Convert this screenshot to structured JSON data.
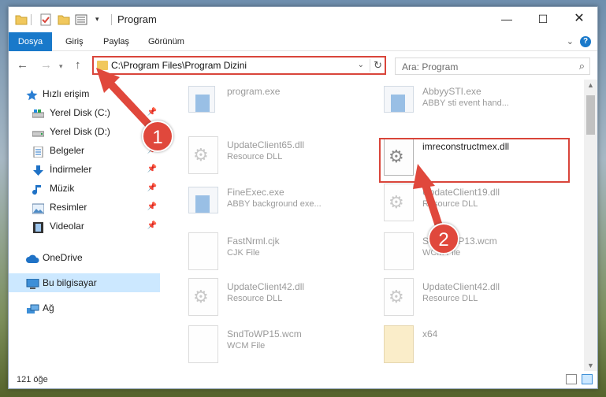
{
  "window": {
    "title": "Program"
  },
  "ribbon": {
    "tabs": [
      "Dosya",
      "Giriş",
      "Paylaş",
      "Görünüm"
    ]
  },
  "address": {
    "path": "C:\\Program Files\\Program Dizini"
  },
  "search": {
    "placeholder": "Ara: Program"
  },
  "sidebar": {
    "items": [
      {
        "label": "Hızlı erişim",
        "icon": "star-icon"
      },
      {
        "label": "Yerel Disk (C:)",
        "icon": "drive-icon"
      },
      {
        "label": "Yerel Disk (D:)",
        "icon": "drive-icon"
      },
      {
        "label": "Belgeler",
        "icon": "documents-icon"
      },
      {
        "label": "İndirmeler",
        "icon": "download-icon"
      },
      {
        "label": "Müzik",
        "icon": "music-icon"
      },
      {
        "label": "Resimler",
        "icon": "pictures-icon"
      },
      {
        "label": "Videolar",
        "icon": "video-icon"
      },
      {
        "label": "OneDrive",
        "icon": "cloud-icon"
      },
      {
        "label": "Bu bilgisayar",
        "icon": "computer-icon"
      },
      {
        "label": "Ağ",
        "icon": "network-icon"
      }
    ]
  },
  "files": [
    {
      "name": "program.exe",
      "type": ""
    },
    {
      "name": "AbbyySTI.exe",
      "type": "ABBY sti event hand..."
    },
    {
      "name": "UpdateClient65.dll",
      "type": "Resource DLL"
    },
    {
      "name": "imreconstructmex.dll",
      "type": ""
    },
    {
      "name": "FineExec.exe",
      "type": "ABBY background exe..."
    },
    {
      "name": "UpdateClient19.dll",
      "type": "Resource DLL"
    },
    {
      "name": "FastNrml.cjk",
      "type": "CJK File"
    },
    {
      "name": "SndToWP13.wcm",
      "type": "WCM File"
    },
    {
      "name": "UpdateClient42.dll",
      "type": "Resource DLL"
    },
    {
      "name": "UpdateClient42.dll",
      "type": "Resource DLL"
    },
    {
      "name": "SndToWP15.wcm",
      "type": "WCM File"
    },
    {
      "name": "x64",
      "type": ""
    }
  ],
  "status": {
    "count": "121 öğe"
  },
  "annotations": {
    "badge1": "1",
    "badge2": "2",
    "color": "#e0483c"
  }
}
